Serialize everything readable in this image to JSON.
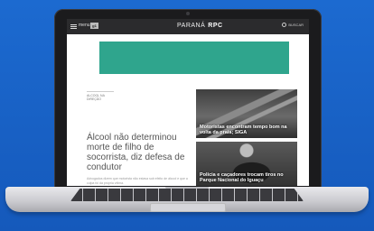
{
  "colors": {
    "background": "#1a63c8",
    "ad_banner": "#2fa58d"
  },
  "site": {
    "menu_label": "menu",
    "badge": "g1",
    "brand_left": "PARANÁ",
    "brand_right": "RPC",
    "search_label": "BUSCAR"
  },
  "main_story": {
    "kicker": "ALCOOL NA DIREÇÃO",
    "headline": "Álcool não determinou morte de filho de socorrista, diz defesa de condutor",
    "summary": "Advogados dizem que motorista não estava sob efeito de álcool e que a culpa foi da própria vítima."
  },
  "cards": [
    {
      "tag": "",
      "title": "Motoristas encontram tempo bom na volta da praia; SIGA"
    },
    {
      "tag": "",
      "title": "Polícia e caçadores trocam tiros no Parque Nacional do Iguaçu"
    }
  ]
}
